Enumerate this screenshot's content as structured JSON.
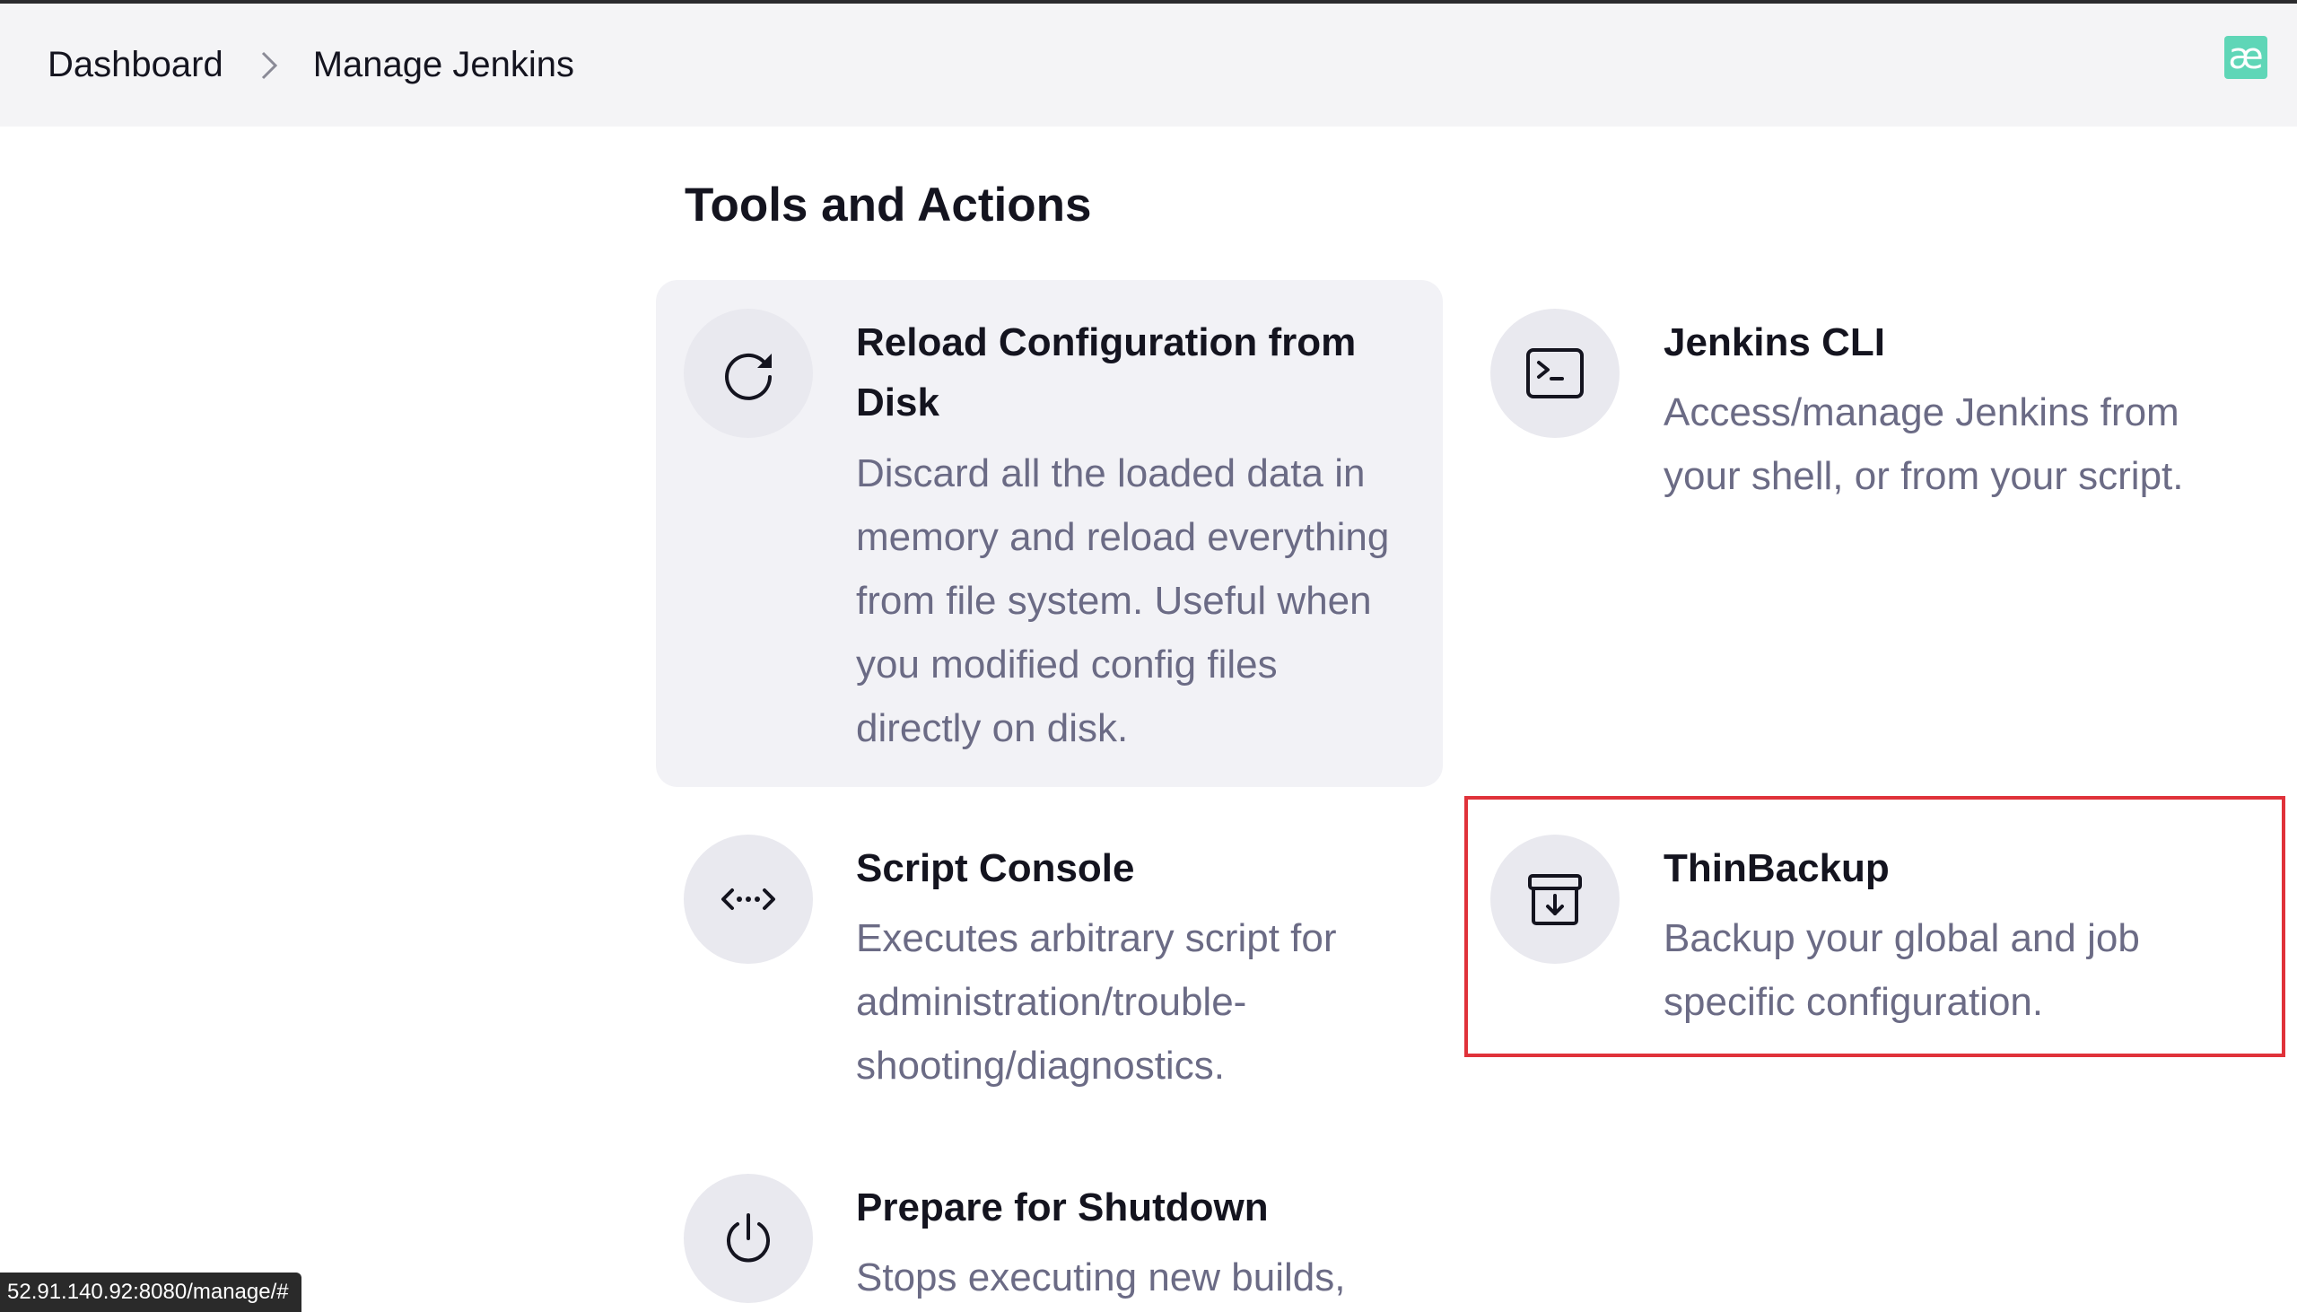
{
  "breadcrumb": {
    "items": [
      "Dashboard",
      "Manage Jenkins"
    ]
  },
  "header": {
    "logo_glyph": "æ"
  },
  "section": {
    "title": "Tools and Actions"
  },
  "cards": [
    {
      "title": "Reload Configuration from Disk",
      "description": "Discard all the loaded data in memory and reload everything from file system. Useful when you modified config files directly on disk.",
      "icon": "reload-icon"
    },
    {
      "title": "Jenkins CLI",
      "description": "Access/manage Jenkins from your shell, or from your script.",
      "icon": "terminal-icon"
    },
    {
      "title": "Script Console",
      "description": "Executes arbitrary script for administration/trouble-shooting/diagnostics.",
      "icon": "code-icon"
    },
    {
      "title": "ThinBackup",
      "description": "Backup your global and job specific configuration.",
      "icon": "archive-download-icon"
    },
    {
      "title": "Prepare for Shutdown",
      "description": "Stops executing new builds,",
      "icon": "power-icon"
    }
  ],
  "status_bar": {
    "url": "52.91.140.92:8080/manage/#"
  },
  "colors": {
    "highlight": "#e0323a",
    "logo": "#5fd6b7",
    "description_text": "#6b6b85"
  }
}
